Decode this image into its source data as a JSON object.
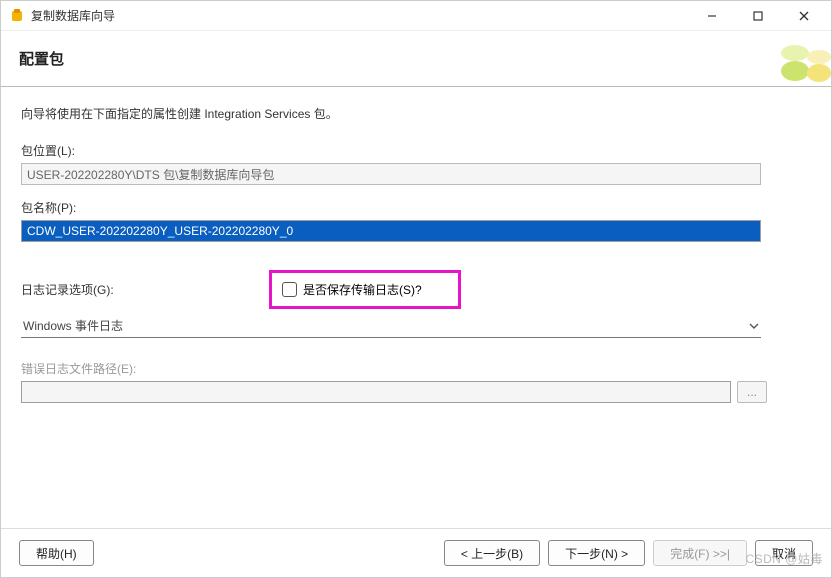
{
  "window": {
    "title": "复制数据库向导"
  },
  "header": {
    "title": "配置包"
  },
  "content": {
    "description": "向导将使用在下面指定的属性创建 Integration Services 包。",
    "package_location_label": "包位置(L):",
    "package_location_value": "USER-202202280Y\\DTS 包\\复制数据库向导包",
    "package_name_label": "包名称(P):",
    "package_name_value": "CDW_USER-202202280Y_USER-202202280Y_0",
    "logging_options_label": "日志记录选项(G):",
    "save_log_checkbox_label": "是否保存传输日志(S)?",
    "logging_select_value": "Windows 事件日志",
    "error_log_path_label": "错误日志文件路径(E):",
    "error_log_path_value": "",
    "browse_btn": "..."
  },
  "footer": {
    "help": "帮助(H)",
    "back": "< 上一步(B)",
    "next": "下一步(N) >",
    "finish": "完成(F) >>|",
    "cancel": "取消"
  },
  "watermark": "CSDN @姑毒"
}
